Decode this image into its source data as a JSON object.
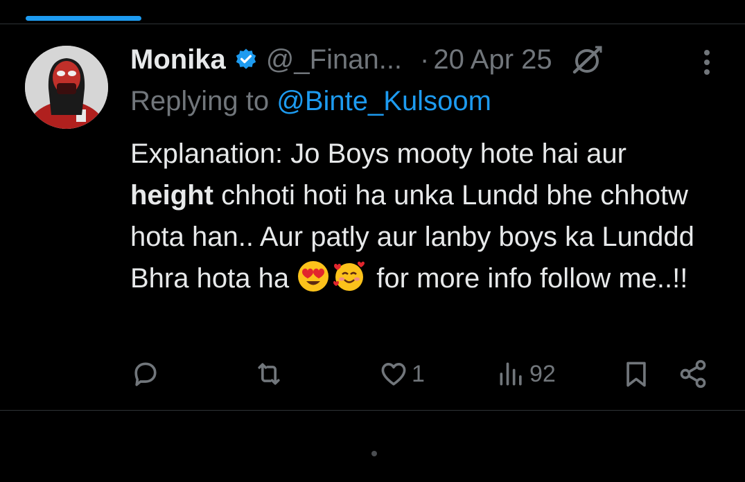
{
  "author": {
    "name": "Monika",
    "handle": "@_Finan...",
    "separator": "·",
    "date": "20 Apr 25"
  },
  "reply": {
    "prefix": "Replying to ",
    "mention": "@Binte_Kulsoom"
  },
  "tweet": {
    "segment_1": "Explanation: Jo Boys mooty hote hai aur ",
    "bold": "height",
    "segment_2": " chhoti hoti ha unka Lundd bhe chhotw hota han.. Aur patly aur lanby boys ka Lunddd Bhra hota ha ",
    "segment_3": " for more info follow me..!!",
    "emojis": [
      "heart-eyes-emoji",
      "smiling-face-with-hearts-emoji"
    ]
  },
  "actions": {
    "reply_count": "",
    "retweet_count": "",
    "like_count": "1",
    "views_count": "92"
  },
  "colors": {
    "background": "#000000",
    "text": "#e7e9ea",
    "muted": "#71767b",
    "accent": "#1d9bf0",
    "divider": "#2f3336"
  },
  "icons": [
    "verified-badge-icon",
    "grok-icon",
    "more-options-icon",
    "reply-icon",
    "retweet-icon",
    "like-icon",
    "views-icon",
    "bookmark-icon",
    "share-icon"
  ]
}
